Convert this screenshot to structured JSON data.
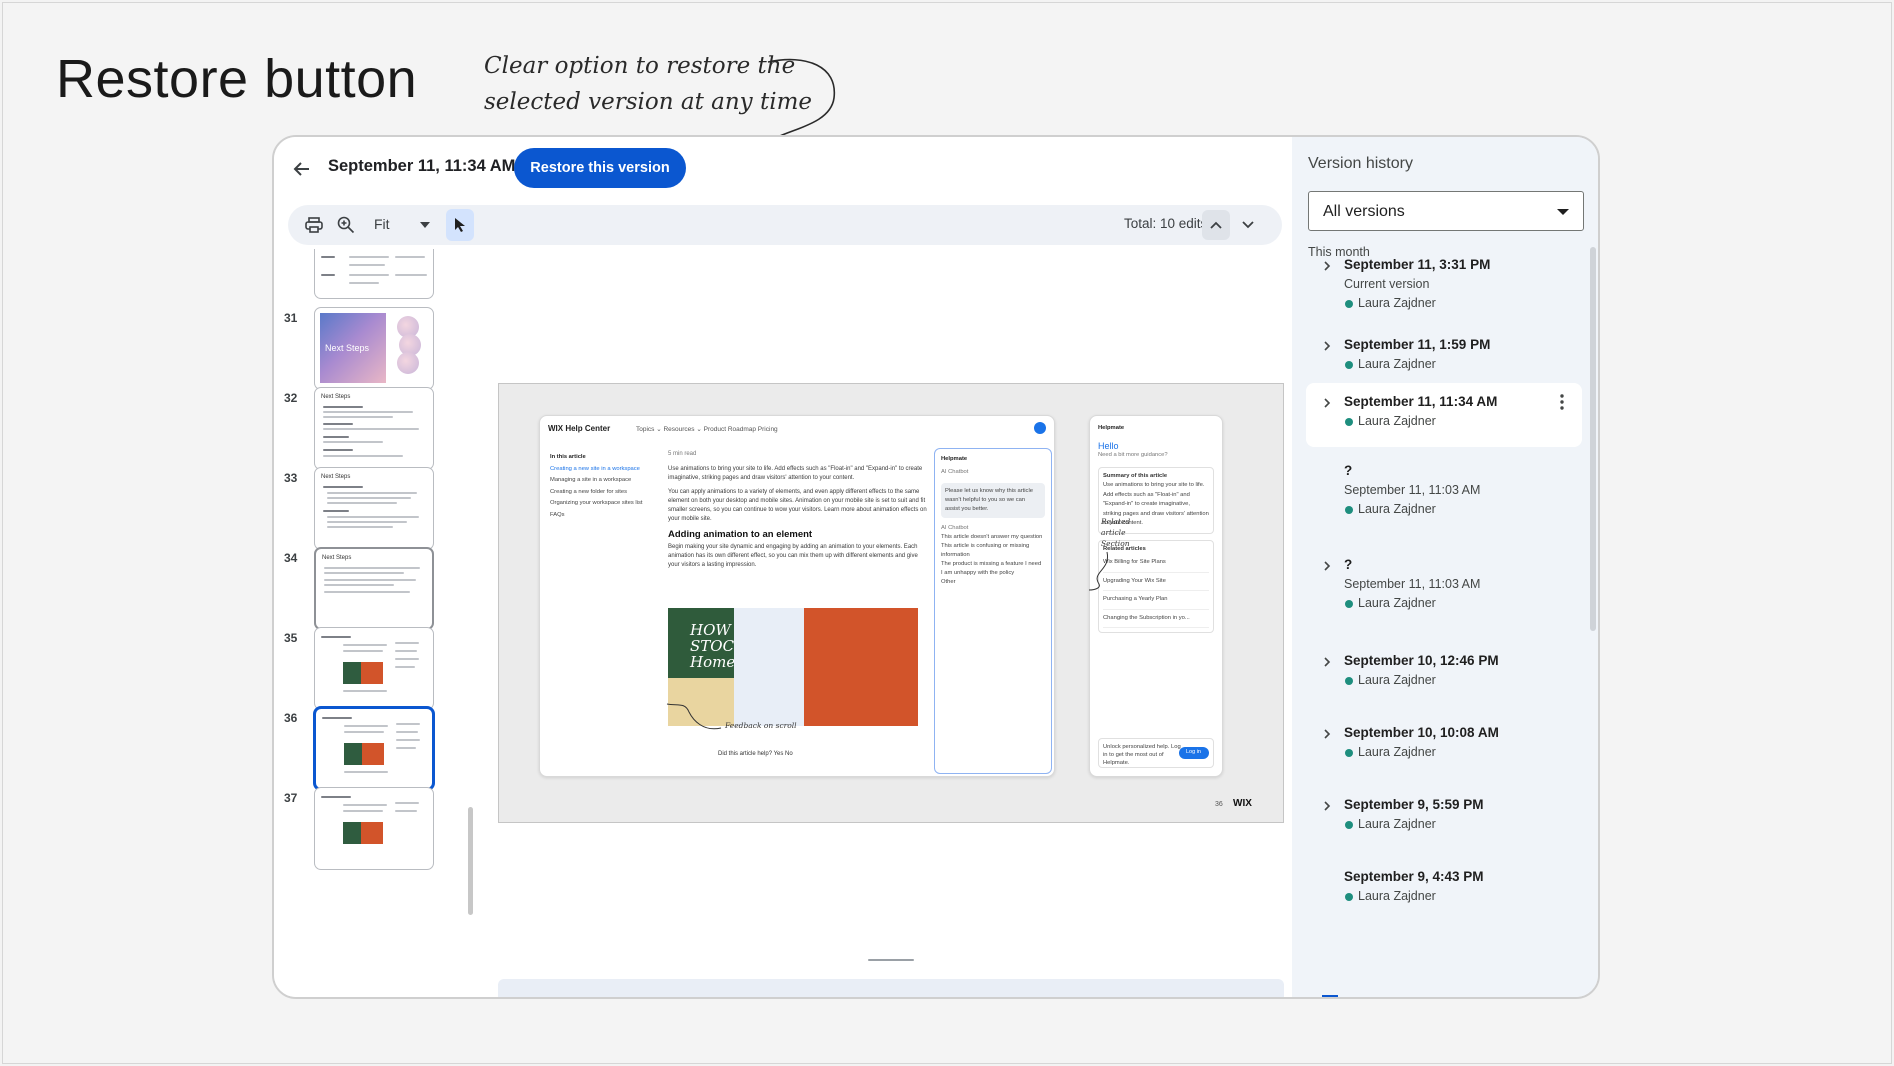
{
  "heading": "Restore button",
  "annotation": {
    "line1": "Clear option to restore the",
    "line2": "selected version at any time"
  },
  "top_bar": {
    "title": "September 11, 11:34 AM",
    "restore_label": "Restore this version"
  },
  "toolbar": {
    "zoom_value": "Fit",
    "total_edits": "Total: 10 edits"
  },
  "icons": {
    "back": "arrow-left-icon",
    "print": "printer-icon",
    "zoom": "zoom-in-icon",
    "select": "cursor-arrow-icon",
    "up": "chevron-up-icon",
    "down": "chevron-down-icon",
    "expand": "chevron-right-icon",
    "more": "more-vert-icon"
  },
  "thumbnails": [
    {
      "num": "31",
      "title": "Next Steps"
    },
    {
      "num": "32",
      "title": "Next Steps"
    },
    {
      "num": "33",
      "title": "Next Steps"
    },
    {
      "num": "34",
      "title": "Next Steps"
    },
    {
      "num": "35"
    },
    {
      "num": "36",
      "active": true
    },
    {
      "num": "37"
    }
  ],
  "canvas": {
    "site_name": "WIX Help Center",
    "nav_links": "Topics ⌄    Resources ⌄    Product Roadmap    Pricing",
    "side_header": "In this article",
    "side_items": [
      "Creating a new site in a workspace",
      "Managing a site in a workspace",
      "Creating a new folder for sites",
      "Organizing your workspace sites list",
      "FAQs"
    ],
    "article_meta": "5 min read",
    "article_intro": "Use animations to bring your site to life. Add effects such as \"Float-in\" and \"Expand-in\" to create imaginative, striking pages and draw visitors' attention to your content.",
    "article_para": "You can apply animations to a variety of elements, and even apply different effects to the same element on both your desktop and mobile sites. Animation on your mobile site is set to suit and fit smaller screens, so you can continue to wow your visitors. Learn more about animation effects on your mobile site.",
    "article_heading": "Adding animation to an element",
    "article_body": "Begin making your site dynamic and engaging by adding an animation to your elements. Each animation has its own different effect, so you can mix them up with different elements and give your visitors a lasting impression.",
    "hero_text": "HOW STOC Home",
    "article_footer": "Did this article help?   Yes   No",
    "chat_title": "Helpmate",
    "chat_tag": "AI Chatbot",
    "chat_bubble": "Please let us know why this article wasn't helpful to you so we can assist you better.",
    "chat_options": [
      "This article doesn't answer my question",
      "This article is confusing or missing information",
      "The product is missing a feature I need",
      "I am unhappy with the policy",
      "Other"
    ],
    "helpmate_title": "Helpmate",
    "helpmate_hello": "Hello",
    "helpmate_sub": "Need a bit more guidance?",
    "helpmate_summary_title": "Summary of this article",
    "helpmate_summary": "Use animations to bring your site to life. Add effects such as \"Float-in\" and \"Expand-in\" to create imaginative, striking pages and draw visitors' attention to your content.",
    "related_title": "Related articles",
    "related_links": [
      "Wix Billing for Site Plans",
      "Upgrading Your Wix Site",
      "Purchasing a Yearly Plan",
      "Changing the Subscription in yo..."
    ],
    "login_text": "Unlock personalized help. Log in to get the most out of Helpmate.",
    "login_button": "Log in",
    "note_feedback": "Feedback on scroll",
    "note_related": "Related article Section",
    "page_number": "36",
    "logo": "WIX"
  },
  "version_panel": {
    "title": "Version history",
    "filter": "All versions",
    "group": "This month",
    "entries": [
      {
        "name": "September 11, 3:31 PM",
        "sub": "Current version",
        "author": "Laura Zajdner",
        "expandable": true
      },
      {
        "name": "September 11, 1:59 PM",
        "author": "Laura Zajdner",
        "expandable": true
      },
      {
        "name": "September 11, 11:34 AM",
        "author": "Laura Zajdner",
        "expandable": true,
        "selected": true
      },
      {
        "name": "?",
        "date": "September 11, 11:03 AM",
        "author": "Laura Zajdner",
        "expandable": false
      },
      {
        "name": "?",
        "date": "September 11, 11:03 AM",
        "author": "Laura Zajdner",
        "expandable": true
      },
      {
        "name": "September 10, 12:46 PM",
        "author": "Laura Zajdner",
        "expandable": true
      },
      {
        "name": "September 10, 10:08 AM",
        "author": "Laura Zajdner",
        "expandable": true
      },
      {
        "name": "September 9, 5:59 PM",
        "author": "Laura Zajdner",
        "expandable": true
      },
      {
        "name": "September 9, 4:43 PM",
        "author": "Laura Zajdner",
        "expandable": false
      }
    ]
  },
  "colors": {
    "primary": "#0b57d0",
    "author_dot": "#1e8e7e",
    "panel_bg": "#f0f4f9"
  }
}
